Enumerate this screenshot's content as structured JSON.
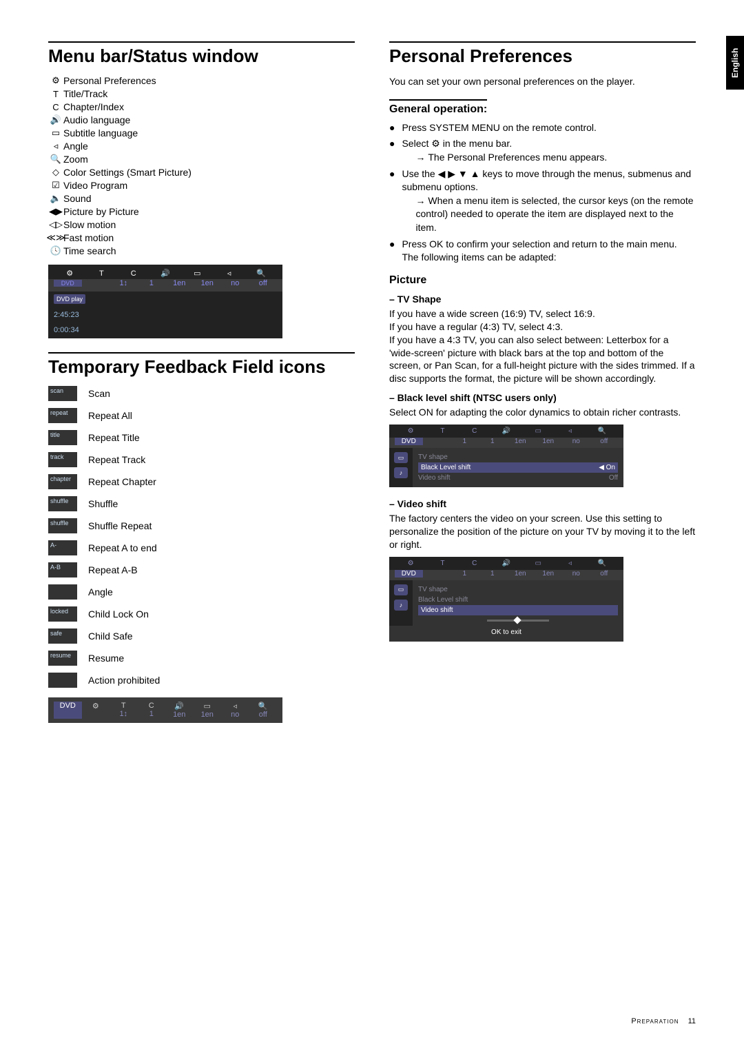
{
  "side_tab": "English",
  "left": {
    "heading1": "Menu bar/Status window",
    "menubar_items": [
      {
        "icon": "⚙",
        "label": "Personal Preferences"
      },
      {
        "icon": "T",
        "label": "Title/Track"
      },
      {
        "icon": "C",
        "label": "Chapter/Index"
      },
      {
        "icon": "🔊",
        "label": "Audio language"
      },
      {
        "icon": "▭",
        "label": "Subtitle language"
      },
      {
        "icon": "◃",
        "label": "Angle"
      },
      {
        "icon": "🔍",
        "label": "Zoom"
      },
      {
        "icon": "◇",
        "label": "Color Settings (Smart Picture)"
      },
      {
        "icon": "☑",
        "label": "Video Program"
      },
      {
        "icon": "🔈",
        "label": "Sound"
      },
      {
        "icon": "◀▶",
        "label": "Picture by Picture"
      },
      {
        "icon": "◁▷",
        "label": "Slow motion"
      },
      {
        "icon": "≪≫",
        "label": "Fast motion"
      },
      {
        "icon": "🕓",
        "label": "Time search"
      }
    ],
    "osd": {
      "top": [
        "⚙",
        "T",
        "C",
        "🔊",
        "▭",
        "◃",
        "🔍"
      ],
      "mid_left": "DVD",
      "mid": [
        "",
        "1↕",
        "1",
        "1en",
        "1en",
        "no",
        "off"
      ],
      "status1": "DVD  play",
      "time1": "2:45:23",
      "time2": "0:00:34"
    },
    "heading2": "Temporary Feedback Field icons",
    "feedback": [
      {
        "tag": "scan",
        "label": "Scan"
      },
      {
        "tag": "repeat",
        "label": "Repeat All"
      },
      {
        "tag": "title",
        "label": "Repeat Title"
      },
      {
        "tag": "track",
        "label": "Repeat Track"
      },
      {
        "tag": "chapter",
        "label": "Repeat Chapter"
      },
      {
        "tag": "shuffle",
        "label": "Shuffle"
      },
      {
        "tag": "shuffle",
        "label": "Shuffle Repeat"
      },
      {
        "tag": "A-",
        "label": "Repeat A to end"
      },
      {
        "tag": "A-B",
        "label": "Repeat A-B"
      },
      {
        "tag": "",
        "label": "Angle"
      },
      {
        "tag": "locked",
        "label": "Child Lock On"
      },
      {
        "tag": "safe",
        "label": "Child Safe"
      },
      {
        "tag": "resume",
        "label": "Resume"
      },
      {
        "tag": "",
        "label": "Action prohibited"
      }
    ],
    "strip": {
      "left": "DVD",
      "cells": [
        "⚙",
        "T",
        "C",
        "🔊",
        "▭",
        "◃",
        "🔍"
      ],
      "vals": [
        "",
        "1↕",
        "1",
        "1en",
        "1en",
        "no",
        "off"
      ]
    }
  },
  "right": {
    "heading": "Personal Preferences",
    "intro": "You can set your own personal preferences on the player.",
    "general_heading": "General operation:",
    "bul1": "Press SYSTEM MENU on the remote control.",
    "bul2": "Select ⚙ in the menu bar.",
    "bul2_arrow": "The Personal Preferences menu appears.",
    "bul3": "Use the ◀ ▶ ▼ ▲ keys to move through the menus, submenus and submenu options.",
    "bul3_arrow": "When a menu item is selected, the cursor keys (on the remote control) needed to operate the item are displayed next to the item.",
    "bul4": "Press OK to confirm your selection and return to the main menu.",
    "bul4_after": "The following items can be adapted:",
    "picture_heading": "Picture",
    "tvshape_heading": "–  TV Shape",
    "tvshape_body": "If you have a wide screen (16:9) TV, select 16:9.\nIf you have a regular (4:3) TV, select 4:3.\nIf you have a 4:3 TV, you can also select between: Letterbox for a 'wide-screen' picture with black bars at the top and bottom of the screen, or Pan Scan, for a full-height picture with the sides trimmed. If a disc supports the format, the picture will be shown accordingly.",
    "blacklevel_heading": "–  Black level shift (NTSC users only)",
    "blacklevel_body": "Select ON for adapting the color dynamics to obtain richer contrasts.",
    "osd_bl": {
      "top": [
        "⚙",
        "T",
        "C",
        "🔊",
        "▭",
        "◃",
        "🔍"
      ],
      "row2_left": "DVD",
      "row2": [
        "",
        "1",
        "1",
        "1en",
        "1en",
        "no",
        "off"
      ],
      "opts": [
        {
          "name": "TV shape",
          "val": ""
        },
        {
          "name": "Black Level shift",
          "val": "◀ On"
        },
        {
          "name": "Video shift",
          "val": "Off"
        }
      ],
      "active_index": 1
    },
    "videoshift_heading": "–  Video shift",
    "videoshift_body": "The factory centers the video on your screen. Use this setting to personalize the position of the picture on your TV by moving it to the left or right.",
    "osd_vs": {
      "top": [
        "⚙",
        "T",
        "C",
        "🔊",
        "▭",
        "◃",
        "🔍"
      ],
      "row2_left": "DVD",
      "row2": [
        "",
        "1",
        "1",
        "1en",
        "1en",
        "no",
        "off"
      ],
      "opts": [
        {
          "name": "TV shape",
          "val": ""
        },
        {
          "name": "Black Level shift",
          "val": ""
        },
        {
          "name": "Video shift",
          "val": ""
        }
      ],
      "active_index": 2,
      "ok": "OK to exit"
    }
  },
  "footer": {
    "section": "Preparation",
    "page": "11"
  }
}
